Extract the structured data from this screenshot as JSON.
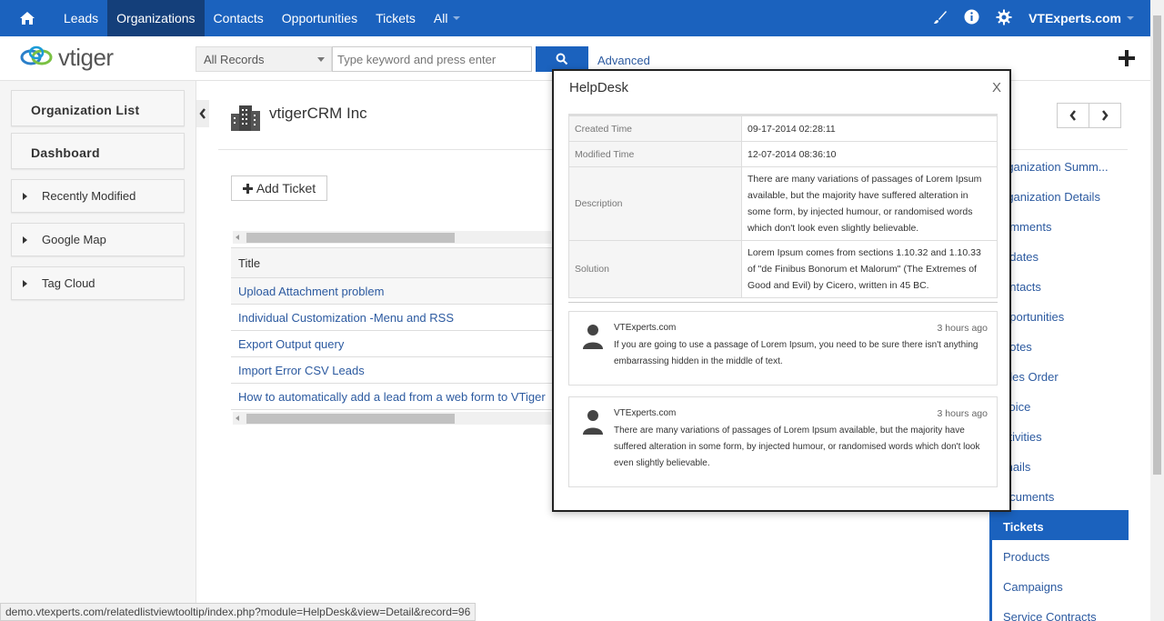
{
  "topnav": {
    "items": [
      "Leads",
      "Organizations",
      "Contacts",
      "Opportunities",
      "Tickets",
      "All"
    ],
    "active": "Organizations",
    "user": "VTExperts.com"
  },
  "header": {
    "logo_text": "vtiger",
    "records_select": "All Records",
    "search_placeholder": "Type keyword and press enter",
    "advanced": "Advanced"
  },
  "sidebar": {
    "org_list": "Organization List",
    "dashboard": "Dashboard",
    "widgets": [
      "Recently Modified",
      "Google Map",
      "Tag Cloud"
    ]
  },
  "main": {
    "org_name": "vtigerCRM Inc",
    "add_ticket": "Add Ticket",
    "table_header": "Title",
    "rows": [
      "Upload Attachment problem",
      "Individual Customization -Menu and RSS",
      "Export Output query",
      "Import Error CSV Leads",
      "How to automatically add a lead from a web form to VTiger"
    ]
  },
  "related": {
    "items": [
      "rganization Summ...",
      "rganization Details",
      "omments",
      "pdates",
      "ontacts",
      "pportunities",
      "uotes",
      "ales Order",
      "voice",
      "ctivities",
      "mails",
      "ocuments",
      "Tickets",
      "Products",
      "Campaigns",
      "Service Contracts"
    ],
    "active": "Tickets"
  },
  "popup": {
    "title": "HelpDesk",
    "close": "X",
    "fields": [
      {
        "label": "Created Time",
        "value": "09-17-2014 02:28:11"
      },
      {
        "label": "Modified Time",
        "value": "12-07-2014 08:36:10"
      },
      {
        "label": "Description",
        "value": "There are many variations of passages of Lorem Ipsum available, but the majority have suffered alteration in some form, by injected humour, or randomised words which don't look even slightly believable."
      },
      {
        "label": "Solution",
        "value": "Lorem Ipsum comes from sections 1.10.32 and 1.10.33 of \"de Finibus Bonorum et Malorum\" (The Extremes of Good and Evil) by Cicero, written in 45 BC."
      }
    ],
    "comments": [
      {
        "author": "VTExperts.com",
        "time": "3 hours ago",
        "text": "If you are going to use a passage of Lorem Ipsum, you need to be sure there isn't anything embarrassing hidden in the middle of text."
      },
      {
        "author": "VTExperts.com",
        "time": "3 hours ago",
        "text": "There are many variations of passages of Lorem Ipsum available, but the majority have suffered alteration in some form, by injected humour, or randomised words which don't look even slightly believable."
      }
    ]
  },
  "statusbar": "demo.vtexperts.com/relatedlistviewtooltip/index.php?module=HelpDesk&view=Detail&record=96",
  "colors": {
    "primary": "#1b62be",
    "active_nav": "#143f7a",
    "link": "#2c5aa0"
  }
}
